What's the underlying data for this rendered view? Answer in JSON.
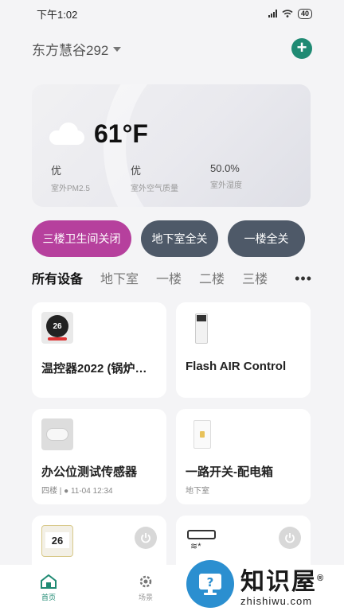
{
  "status_bar": {
    "time": "下午1:02",
    "battery": "40"
  },
  "header": {
    "home_name": "东方慧谷292",
    "add_label": "+"
  },
  "weather": {
    "temperature": "61°F",
    "stats": [
      {
        "value": "优",
        "label": "室外PM2.5"
      },
      {
        "value": "优",
        "label": "室外空气质量"
      },
      {
        "value": "50.0%",
        "label": "室外湿度"
      }
    ]
  },
  "scenes": [
    {
      "label": "三楼卫生间关闭",
      "color": "#b6409d"
    },
    {
      "label": "地下室全关",
      "color": "#4e5968"
    },
    {
      "label": "一楼全关",
      "color": "#4e5968"
    }
  ],
  "tabs": [
    "所有设备",
    "地下室",
    "一楼",
    "二楼",
    "三楼"
  ],
  "more_label": "•••",
  "devices": [
    {
      "name": "温控器2022 (锅炉…",
      "sub": ""
    },
    {
      "name": "Flash AIR Control",
      "sub": ""
    },
    {
      "name": "办公位测试传感器",
      "sub": "四楼 | ● 11-04 12:34"
    },
    {
      "name": "一路开关-配电箱",
      "sub": "地下室"
    },
    {
      "name": "",
      "sub": "",
      "display": "26"
    },
    {
      "name": "",
      "sub": ""
    }
  ],
  "thermostat_display": "26",
  "bottom_nav": [
    {
      "label": "首页",
      "icon": "home-icon"
    },
    {
      "label": "场景",
      "icon": "gear-icon"
    },
    {
      "label": "",
      "icon": ""
    }
  ],
  "watermark": {
    "cn": "知识屋",
    "en": "zhishiwu.com",
    "reg": "®"
  },
  "colors": {
    "accent": "#1f8a73",
    "scene_pink": "#b6409d",
    "scene_gray": "#4e5968"
  }
}
